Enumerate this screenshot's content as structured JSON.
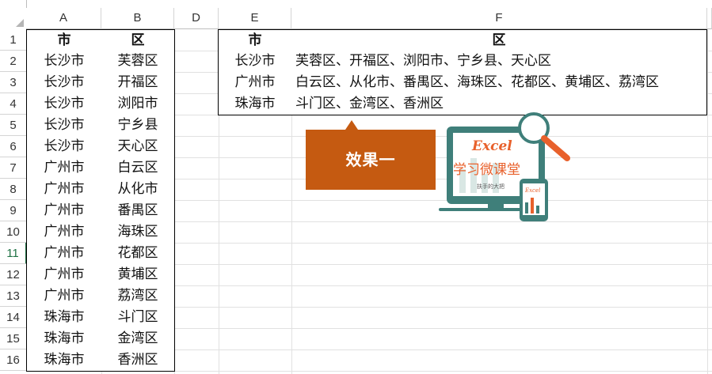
{
  "sheet": {
    "columns": [
      "A",
      "B",
      "",
      "D",
      "E",
      "F"
    ],
    "rows": [
      "1",
      "2",
      "3",
      "4",
      "5",
      "6",
      "7",
      "8",
      "9",
      "10",
      "11",
      "12",
      "13",
      "14",
      "15",
      "16"
    ],
    "active_row": "11"
  },
  "left_table": {
    "headers": [
      "市",
      "区"
    ],
    "rows": [
      [
        "长沙市",
        "芙蓉区"
      ],
      [
        "长沙市",
        "开福区"
      ],
      [
        "长沙市",
        "浏阳市"
      ],
      [
        "长沙市",
        "宁乡县"
      ],
      [
        "长沙市",
        "天心区"
      ],
      [
        "广州市",
        "白云区"
      ],
      [
        "广州市",
        "从化市"
      ],
      [
        "广州市",
        "番禺区"
      ],
      [
        "广州市",
        "海珠区"
      ],
      [
        "广州市",
        "花都区"
      ],
      [
        "广州市",
        "黄埔区"
      ],
      [
        "广州市",
        "荔湾区"
      ],
      [
        "珠海市",
        "斗门区"
      ],
      [
        "珠海市",
        "金湾区"
      ],
      [
        "珠海市",
        "香洲区"
      ]
    ]
  },
  "right_table": {
    "headers": [
      "市",
      "区"
    ],
    "rows": [
      [
        "长沙市",
        "芙蓉区、开福区、浏阳市、宁乡县、天心区"
      ],
      [
        "广州市",
        "白云区、从化市、番禺区、海珠区、花都区、黄埔区、荔湾区"
      ],
      [
        "珠海市",
        "斗门区、金湾区、香洲区"
      ]
    ]
  },
  "callout": {
    "label": "效果一",
    "color": "#C55A11"
  },
  "logo": {
    "title": "Excel",
    "subtitle": "学习微课堂",
    "small_text": "扶手的大把",
    "phone_text": "Excel",
    "accent": "#E8612C",
    "frame": "#3F7F7A"
  }
}
